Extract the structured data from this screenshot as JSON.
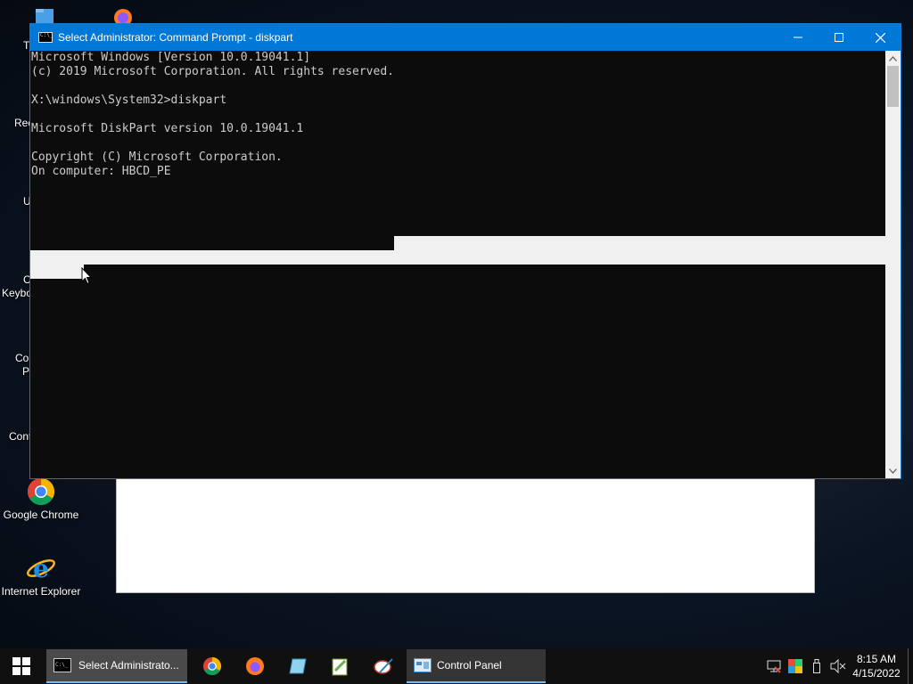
{
  "window": {
    "title": "Select Administrator: Command Prompt - diskpart",
    "console_lines": [
      "Microsoft Windows [Version 10.0.19041.1]",
      "(c) 2019 Microsoft Corporation. All rights reserved.",
      "",
      "X:\\windows\\System32>diskpart",
      "",
      "Microsoft DiskPart version 10.0.19041.1",
      "",
      "Copyright (C) Microsoft Corporation.",
      "On computer: HBCD_PE"
    ],
    "controls": {
      "minimize_icon": "minimize-icon",
      "maximize_icon": "maximize-icon",
      "close_icon": "close-icon"
    }
  },
  "desktop": {
    "partial_labels": [
      "T",
      "Rec",
      "U",
      "C",
      "Keybo",
      "Co",
      "P",
      "Cont"
    ],
    "icons": [
      {
        "label": "Google Chrome",
        "icon": "chrome-icon"
      },
      {
        "label": "Internet Explorer",
        "icon": "internet-explorer-icon"
      }
    ]
  },
  "taskbar": {
    "start_icon": "windows-start-icon",
    "cmd_button_label": "Select Administrato...",
    "pinned": [
      "chrome-icon",
      "firefox-icon",
      "notepad-icon",
      "notepad-plus-icon",
      "paint-icon"
    ],
    "control_panel_label": "Control Panel",
    "tray_icons": [
      "network-icon",
      "color-icon",
      "usb-icon",
      "volume-muted-icon"
    ],
    "time": "8:15 AM",
    "date": "4/15/2022"
  },
  "colors": {
    "titlebar": "#0078d7",
    "console_bg": "#0c0c0c",
    "console_text": "#cccccc",
    "selection": "#f0f0f0",
    "taskbar": "#101010"
  }
}
